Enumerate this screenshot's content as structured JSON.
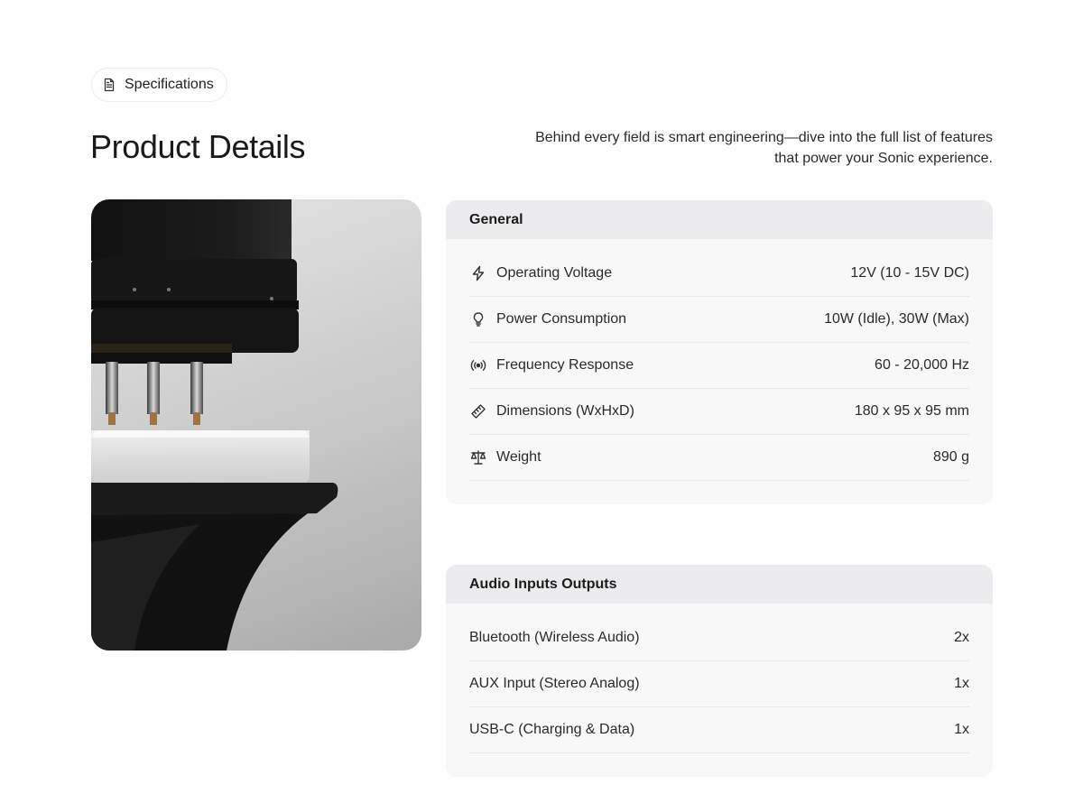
{
  "badge": {
    "label": "Specifications",
    "icon": "document-icon"
  },
  "page": {
    "title": "Product Details",
    "intro": "Behind every field is smart engineering—dive into the full list of features that power your Sonic experience."
  },
  "general": {
    "heading": "General",
    "rows": [
      {
        "icon": "lightning-icon",
        "label": "Operating Voltage",
        "value": "12V (10 - 15V DC)"
      },
      {
        "icon": "lightbulb-icon",
        "label": "Power Consumption",
        "value": "10W (Idle), 30W (Max)"
      },
      {
        "icon": "broadcast-icon",
        "label": "Frequency Response",
        "value": "60 - 20,000 Hz"
      },
      {
        "icon": "ruler-icon",
        "label": "Dimensions (WxHxD)",
        "value": "180 x 95 x 95 mm"
      },
      {
        "icon": "scale-icon",
        "label": "Weight",
        "value": "890 g"
      }
    ]
  },
  "audio": {
    "heading": "Audio Inputs Outputs",
    "rows": [
      {
        "label": "Bluetooth (Wireless Audio)",
        "value": "2x"
      },
      {
        "label": "AUX Input (Stereo Analog)",
        "value": "1x"
      },
      {
        "label": "USB-C (Charging & Data)",
        "value": "1x"
      }
    ]
  }
}
